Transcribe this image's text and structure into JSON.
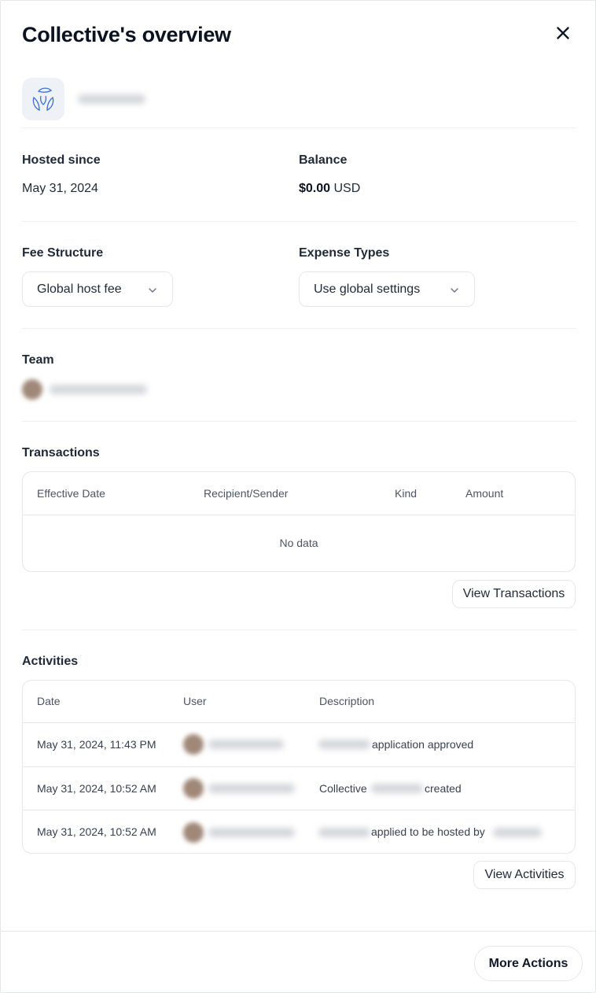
{
  "header": {
    "title": "Collective's overview"
  },
  "details": {
    "hosted_since_label": "Hosted since",
    "hosted_since_value": "May 31, 2024",
    "balance_label": "Balance",
    "balance_amount": "$0.00",
    "balance_currency": "USD"
  },
  "settings": {
    "fee_structure_label": "Fee Structure",
    "fee_structure_value": "Global host fee",
    "expense_types_label": "Expense Types",
    "expense_types_value": "Use global settings"
  },
  "team": {
    "label": "Team"
  },
  "transactions": {
    "label": "Transactions",
    "columns": [
      "Effective Date",
      "Recipient/Sender",
      "Kind",
      "Amount"
    ],
    "empty_text": "No data",
    "view_button": "View Transactions"
  },
  "activities": {
    "label": "Activities",
    "columns": [
      "Date",
      "User",
      "Description"
    ],
    "rows": [
      {
        "date": "May 31, 2024, 11:43 PM",
        "description_text": "application approved"
      },
      {
        "date": "May 31, 2024, 10:52 AM",
        "description_prefix": "Collective",
        "description_text": "created"
      },
      {
        "date": "May 31, 2024, 10:52 AM",
        "description_text": "applied to be hosted by"
      }
    ],
    "view_button": "View Activities"
  },
  "footer": {
    "more_actions": "More Actions"
  }
}
